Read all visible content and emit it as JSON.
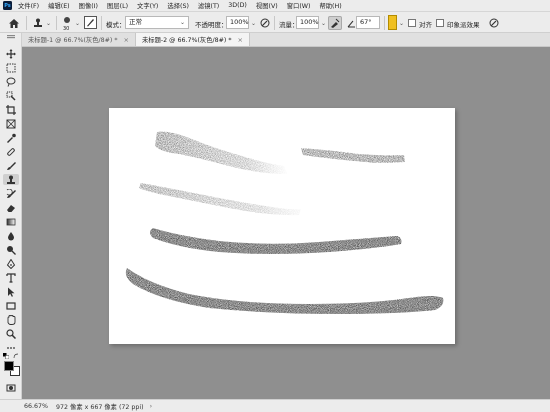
{
  "app": {
    "logo_text": "Ps"
  },
  "menu": [
    "文件(F)",
    "编辑(E)",
    "图像(I)",
    "图层(L)",
    "文字(Y)",
    "选择(S)",
    "滤镜(T)",
    "3D(D)",
    "视图(V)",
    "窗口(W)",
    "帮助(H)"
  ],
  "options": {
    "brush_size": "30",
    "mode_label": "模式：",
    "mode_value": "正常",
    "opacity_label": "不透明度：",
    "opacity_value": "100%",
    "flow_label": "流量：",
    "flow_value": "100%",
    "angle_value": "67°",
    "align_label": "对齐",
    "sample_label": "印象派效果"
  },
  "tabs": [
    {
      "label": "未标题-1 @ 66.7%(灰色/8#) *",
      "close": "×"
    },
    {
      "label": "未标题-2 @ 66.7%(灰色/8#) *",
      "close": "×"
    }
  ],
  "status": {
    "zoom": "66.67%",
    "doc_info": "972 像素 x 667 像素 (72 ppi)",
    "arrow": "›"
  },
  "colors": {
    "workspace_bg": "#8f8f8f",
    "canvas_bg": "#ffffff",
    "ui_bg": "#ececec",
    "stroke_ink": "#333333"
  },
  "icons": {
    "home": "home-icon",
    "tool_preset": "stamp-tool-icon",
    "brush_panel": "brush-settings-icon",
    "pressure": "pressure-icon"
  }
}
